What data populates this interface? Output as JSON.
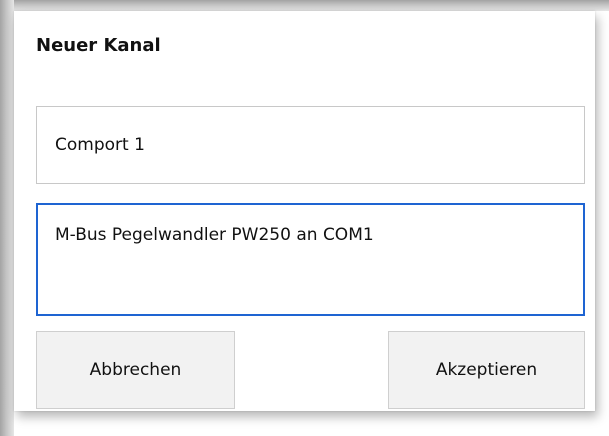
{
  "dialog": {
    "title": "Neuer Kanal",
    "name_field": {
      "value": "Comport 1"
    },
    "description_field": {
      "value": "M-Bus Pegelwandler PW250 an COM1"
    },
    "cancel_label": "Abbrechen",
    "accept_label": "Akzeptieren"
  },
  "colors": {
    "focus_border": "#1e64d2",
    "button_bg": "#f2f2f2",
    "field_border": "#c8c8c8"
  }
}
